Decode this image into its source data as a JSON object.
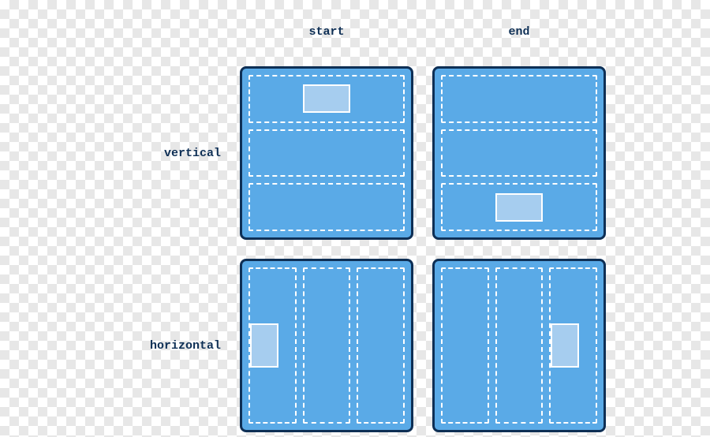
{
  "labels": {
    "col1": "start",
    "col2": "end",
    "row1": "vertical",
    "row2": "horizontal"
  },
  "colors": {
    "panel_bg": "#5aaae7",
    "panel_border": "#0e2f55",
    "dash": "#ffffff",
    "marker_fill": "#a6cdef",
    "marker_border": "#ffffff",
    "text": "#0e2f55"
  },
  "diagram": {
    "rows": [
      "vertical",
      "horizontal"
    ],
    "cols": [
      "start",
      "end"
    ],
    "cells_per_panel": 3,
    "marker_rules": {
      "vertical_start": {
        "cell_index": 0,
        "align": "center"
      },
      "vertical_end": {
        "cell_index": 2,
        "align": "center"
      },
      "horizontal_start": {
        "cell_index": 0,
        "align": "start"
      },
      "horizontal_end": {
        "cell_index": 2,
        "align": "end"
      }
    }
  }
}
